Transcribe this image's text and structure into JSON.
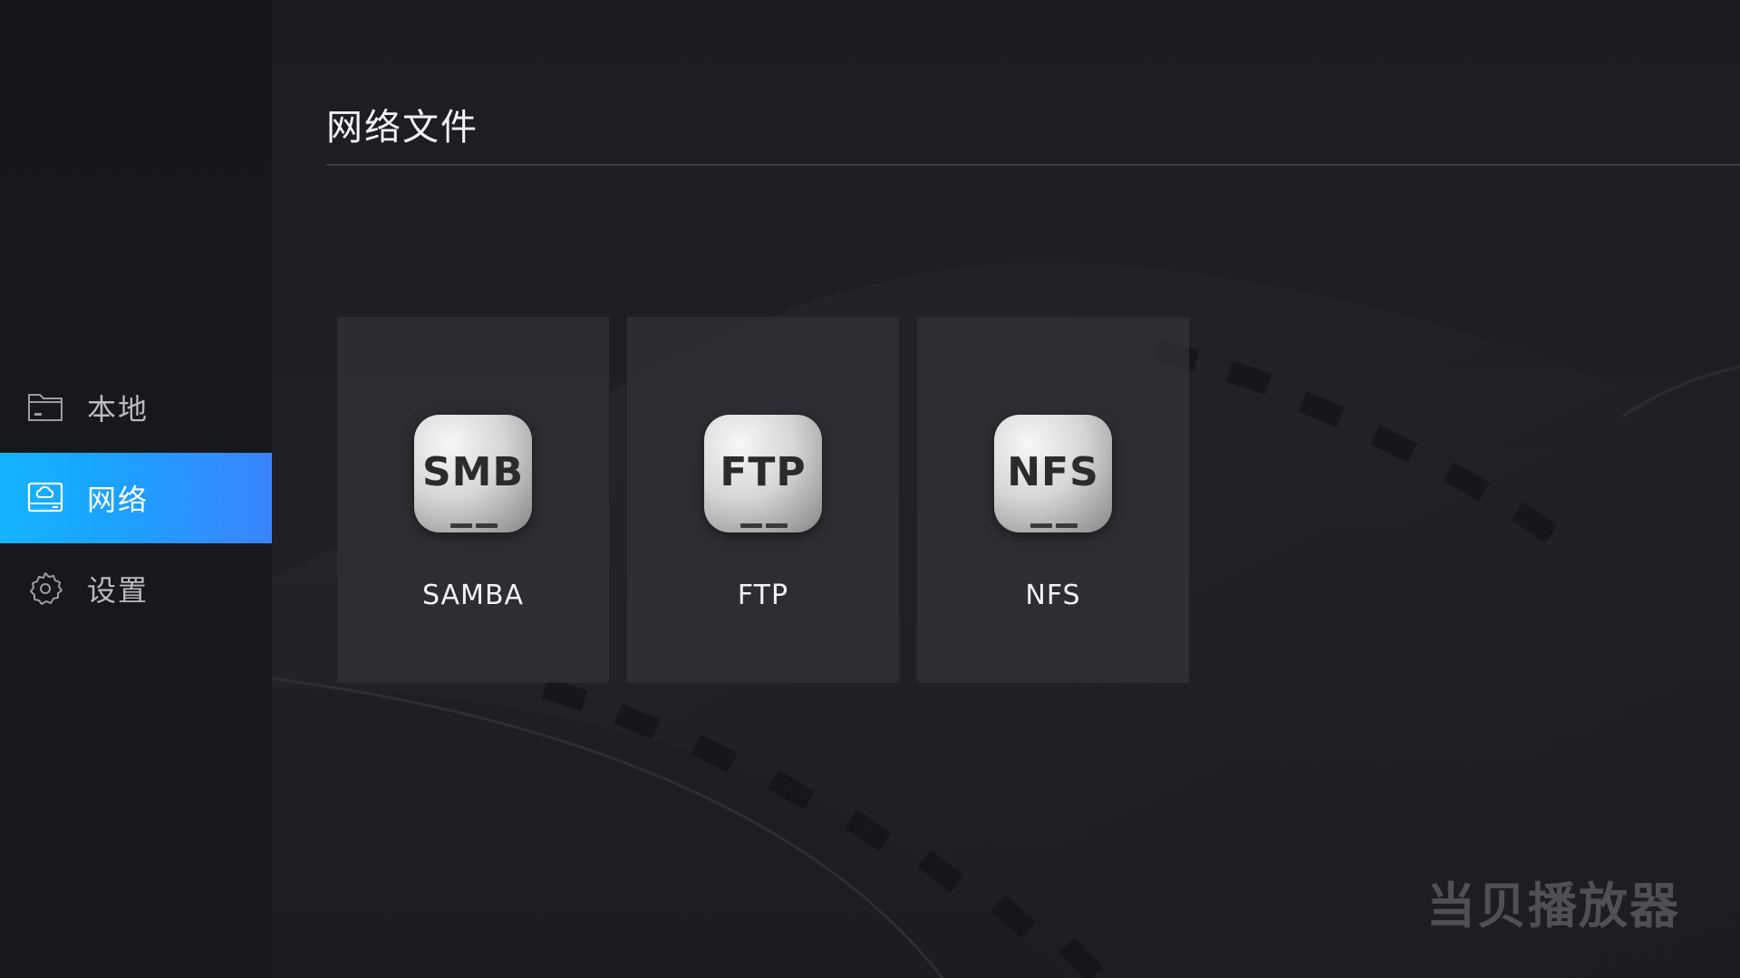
{
  "sidebar": {
    "items": [
      {
        "label": "本地",
        "icon": "folder-icon",
        "active": false
      },
      {
        "label": "网络",
        "icon": "network-drive-icon",
        "active": true
      },
      {
        "label": "设置",
        "icon": "gear-icon",
        "active": false
      }
    ]
  },
  "header": {
    "title": "网络文件"
  },
  "cards": [
    {
      "badge": "SMB",
      "label": "SAMBA",
      "icon": "smb-icon"
    },
    {
      "badge": "FTP",
      "label": "FTP",
      "icon": "ftp-icon"
    },
    {
      "badge": "NFS",
      "label": "NFS",
      "icon": "nfs-icon"
    }
  ],
  "watermark": "当贝播放器",
  "colors": {
    "accent": "#1aa3ff",
    "background": "#1c1d22",
    "sidebar": "#17181c",
    "card": "#323338"
  }
}
